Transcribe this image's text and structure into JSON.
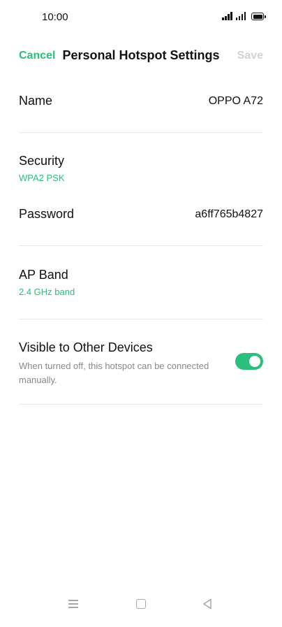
{
  "status_bar": {
    "time": "10:00",
    "icons": [
      "signal-icon",
      "signal-icon",
      "battery-icon"
    ]
  },
  "header": {
    "cancel_label": "Cancel",
    "title": "Personal Hotspot Settings",
    "save_label": "Save"
  },
  "settings": {
    "name": {
      "label": "Name",
      "value": "OPPO A72"
    },
    "security": {
      "label": "Security",
      "value": "WPA2 PSK"
    },
    "password": {
      "label": "Password",
      "value": "a6ff765b4827"
    },
    "ap_band": {
      "label": "AP Band",
      "value": "2.4 GHz band"
    },
    "visible": {
      "label": "Visible to Other Devices",
      "description": "When turned off, this hotspot can be connected manually.",
      "enabled": true
    }
  },
  "colors": {
    "accent": "#2bbf7e",
    "disabled": "#d2d2d2",
    "secondary_text": "#8a8a8a",
    "divider": "#e8e8e8"
  },
  "nav_bar": {
    "icons": [
      "menu-icon",
      "home-icon",
      "back-icon"
    ]
  }
}
